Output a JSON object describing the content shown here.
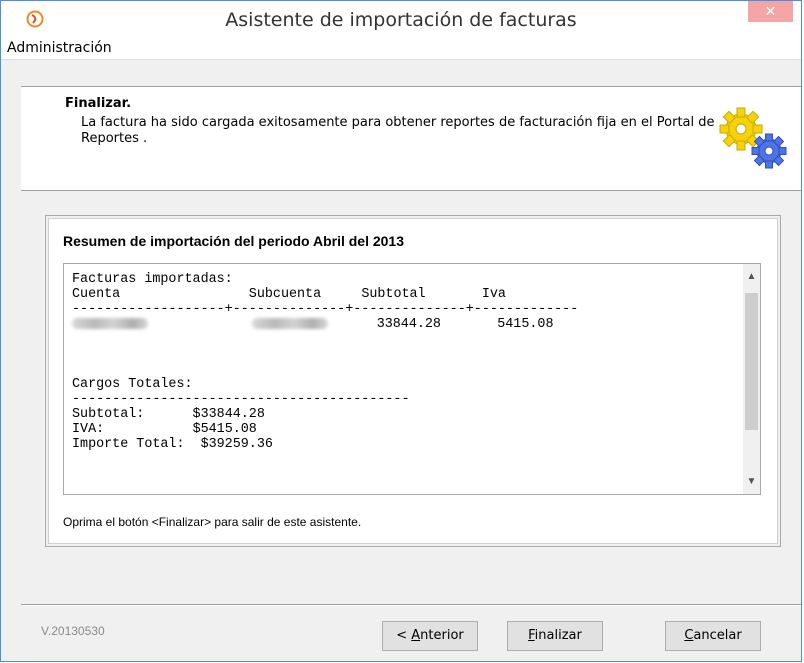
{
  "window": {
    "title": "Asistente de importación de facturas",
    "close_glyph": "✕"
  },
  "menu": {
    "items": [
      "Administración"
    ]
  },
  "header": {
    "title": "Finalizar.",
    "description": "La factura ha sido cargada exitosamente para obtener reportes de facturación fija en el Portal de Reportes .",
    "icon": "gears-icon"
  },
  "summary": {
    "title": "Resumen de importación del periodo Abril del 2013",
    "report": {
      "heading": "Facturas importadas:",
      "columns": [
        "Cuenta",
        "Subcuenta",
        "Subtotal",
        "Iva"
      ],
      "separator": "-------------------+--------------+--------------+-------------",
      "rows": [
        {
          "cuenta": "",
          "subcuenta": "",
          "subtotal": "33844.28",
          "iva": "5415.08"
        }
      ],
      "totals_heading": "Cargos Totales:",
      "totals_separator": "------------------------------------------",
      "totals": [
        {
          "label": "Subtotal:",
          "value": "$33844.28"
        },
        {
          "label": "IVA:",
          "value": "$5415.08"
        },
        {
          "label": "Importe Total:",
          "value": "$39259.36"
        }
      ]
    },
    "footer": "Oprima el botón <Finalizar> para salir de este asistente."
  },
  "version": "V.20130530",
  "buttons": {
    "back": {
      "prefix": "< ",
      "mnemonic": "A",
      "rest": "nterior"
    },
    "finish": {
      "prefix": "",
      "mnemonic": "F",
      "rest": "inalizar"
    },
    "cancel": {
      "prefix": "",
      "mnemonic": "C",
      "rest": "ancelar"
    }
  },
  "colors": {
    "window_border": "#4a90d9",
    "close_button": "#f4a6a6"
  }
}
